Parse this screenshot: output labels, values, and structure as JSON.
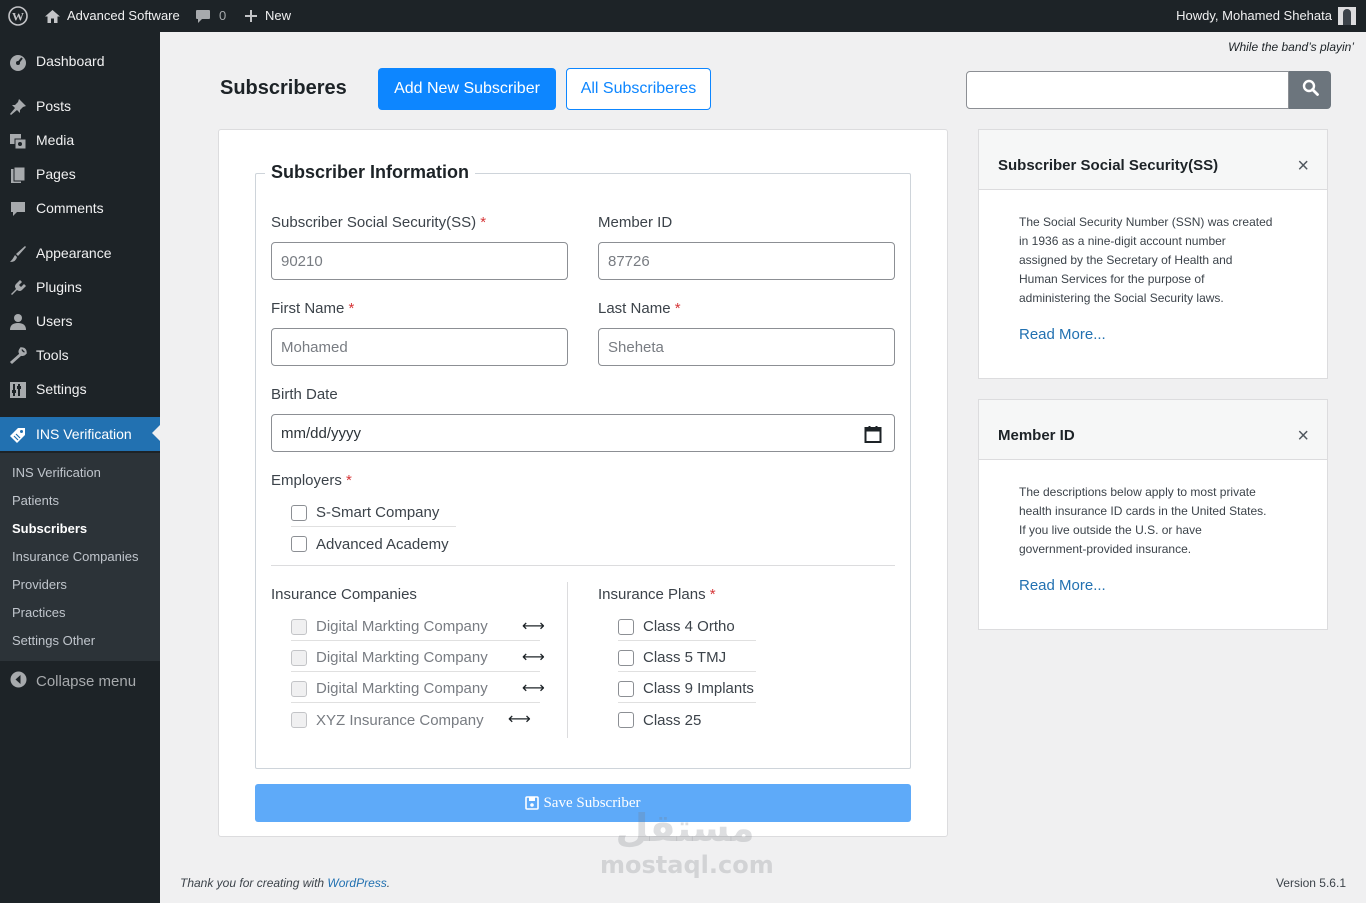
{
  "adminbar": {
    "site_name": "Advanced Software",
    "comments_count": "0",
    "new_label": "New",
    "howdy": "Howdy, Mohamed Shehata"
  },
  "sidebar": {
    "items": [
      {
        "label": "Dashboard",
        "icon": "dashboard-icon"
      },
      {
        "label": "Posts",
        "icon": "pin-icon"
      },
      {
        "label": "Media",
        "icon": "media-icon"
      },
      {
        "label": "Pages",
        "icon": "pages-icon"
      },
      {
        "label": "Comments",
        "icon": "comment-icon"
      },
      {
        "label": "Appearance",
        "icon": "brush-icon"
      },
      {
        "label": "Plugins",
        "icon": "plugin-icon"
      },
      {
        "label": "Users",
        "icon": "user-icon"
      },
      {
        "label": "Tools",
        "icon": "wrench-icon"
      },
      {
        "label": "Settings",
        "icon": "settings-icon"
      },
      {
        "label": "INS Verification",
        "icon": "tag-icon"
      }
    ],
    "submenu": [
      "INS Verification",
      "Patients",
      "Subscribers",
      "Insurance Companies",
      "Providers",
      "Practices",
      "Settings Other"
    ],
    "collapse": "Collapse menu"
  },
  "header": {
    "tagline": "While the band’s playin’",
    "title": "Subscriberes",
    "add_button": "Add New Subscriber",
    "all_button": "All Subscriberes",
    "search_value": ""
  },
  "form": {
    "legend": "Subscriber Information",
    "ss_label": "Subscriber Social Security(SS)",
    "ss_value": "90210",
    "member_label": "Member ID",
    "member_value": "87726",
    "first_label": "First Name",
    "first_value": "Mohamed",
    "last_label": "Last Name",
    "last_value": "Sheheta",
    "birth_label": "Birth Date",
    "birth_placeholder": "mm/dd/yyyy",
    "required_mark": "*",
    "employers_label": "Employers",
    "employers": [
      "S-Smart Company",
      "Advanced Academy"
    ],
    "insurance_label": "Insurance Companies",
    "insurance_companies": [
      "Digital Markting Company",
      "Digital Markting Company",
      "Digital Markting Company",
      "XYZ Insurance Company"
    ],
    "plans_label": "Insurance Plans",
    "plans": [
      "Class 4 Ortho",
      "Class 5 TMJ",
      "Class 9 Implants",
      "Class 25"
    ],
    "arrow_glyph": "⟷",
    "save_label": "Save Subscriber"
  },
  "info_cards": [
    {
      "title": "Subscriber Social Security(SS)",
      "lines": [
        "The Social Security Number (SSN) was created",
        "in 1936 as a nine-digit account number",
        "assigned by the Secretary of Health and",
        "Human Services for the purpose of",
        "administering the Social Security laws."
      ],
      "link": "Read More..."
    },
    {
      "title": "Member ID",
      "lines": [
        "The descriptions below apply to most private",
        "health insurance ID cards in the United States.",
        "If you live outside the U.S. or have",
        "government-provided insurance."
      ],
      "link": "Read More..."
    }
  ],
  "footer": {
    "thanks_prefix": "Thank you for creating with ",
    "thanks_link": "WordPress",
    "thanks_suffix": ".",
    "version": "Version 5.6.1"
  },
  "watermark": {
    "arabic": "مستقل",
    "latin": "mostaql.com"
  },
  "colors": {
    "primary": "#0d86ff",
    "admin_dark": "#1d2327",
    "active_menu": "#2271b1",
    "save_button": "#5eaaf9"
  }
}
